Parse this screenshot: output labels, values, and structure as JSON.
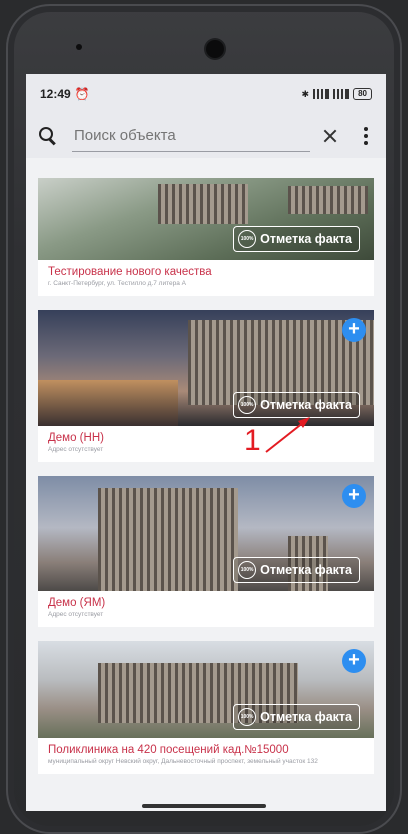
{
  "status": {
    "time": "12:49",
    "battery": "80"
  },
  "search": {
    "placeholder": "Поиск объекта",
    "value": ""
  },
  "cards": [
    {
      "title": "Тестирование нового качества",
      "address": "г. Санкт-Петербург, ул. Тестилло д.7 литера А",
      "badge": "Отметка факта",
      "has_add": false
    },
    {
      "title": "Демо (НН)",
      "address": "Адрес отсутствует",
      "badge": "Отметка факта",
      "has_add": true
    },
    {
      "title": "Демо (ЯМ)",
      "address": "Адрес отсутствует",
      "badge": "Отметка факта",
      "has_add": true
    },
    {
      "title": "Поликлиника на 420 посещений кад.№15000",
      "address": "муниципальный округ Невский округ, Дальневосточный проспект, земельный участок 132",
      "badge": "Отметка факта",
      "has_add": true
    }
  ],
  "annotation": {
    "number": "1",
    "color": "#e31b22"
  },
  "colors": {
    "accent": "#2d8ef0",
    "title": "#c8324a"
  },
  "badge_icon_text": "100%"
}
